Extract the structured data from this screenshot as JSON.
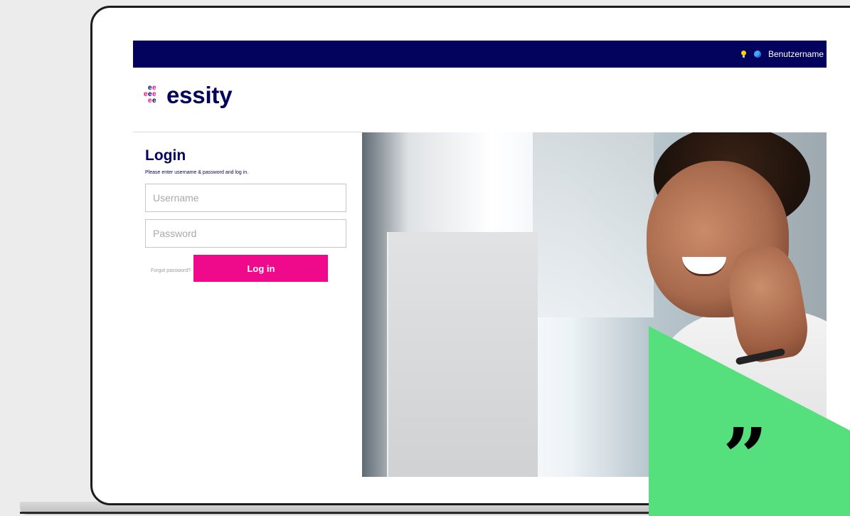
{
  "topbar": {
    "username": "Benutzername"
  },
  "brand": {
    "name": "essity"
  },
  "login": {
    "title": "Login",
    "subtitle": "Please enter username & password and log in.",
    "username_placeholder": "Username",
    "password_placeholder": "Password",
    "forgot_password": "Forgot password?",
    "login_button": "Log in"
  },
  "decor": {
    "quote_mark": "”"
  },
  "colors": {
    "topbar_bg": "#03025c",
    "brand_navy": "#03025c",
    "login_button_bg": "#ee0a8a",
    "accent_green": "#56e07d"
  }
}
